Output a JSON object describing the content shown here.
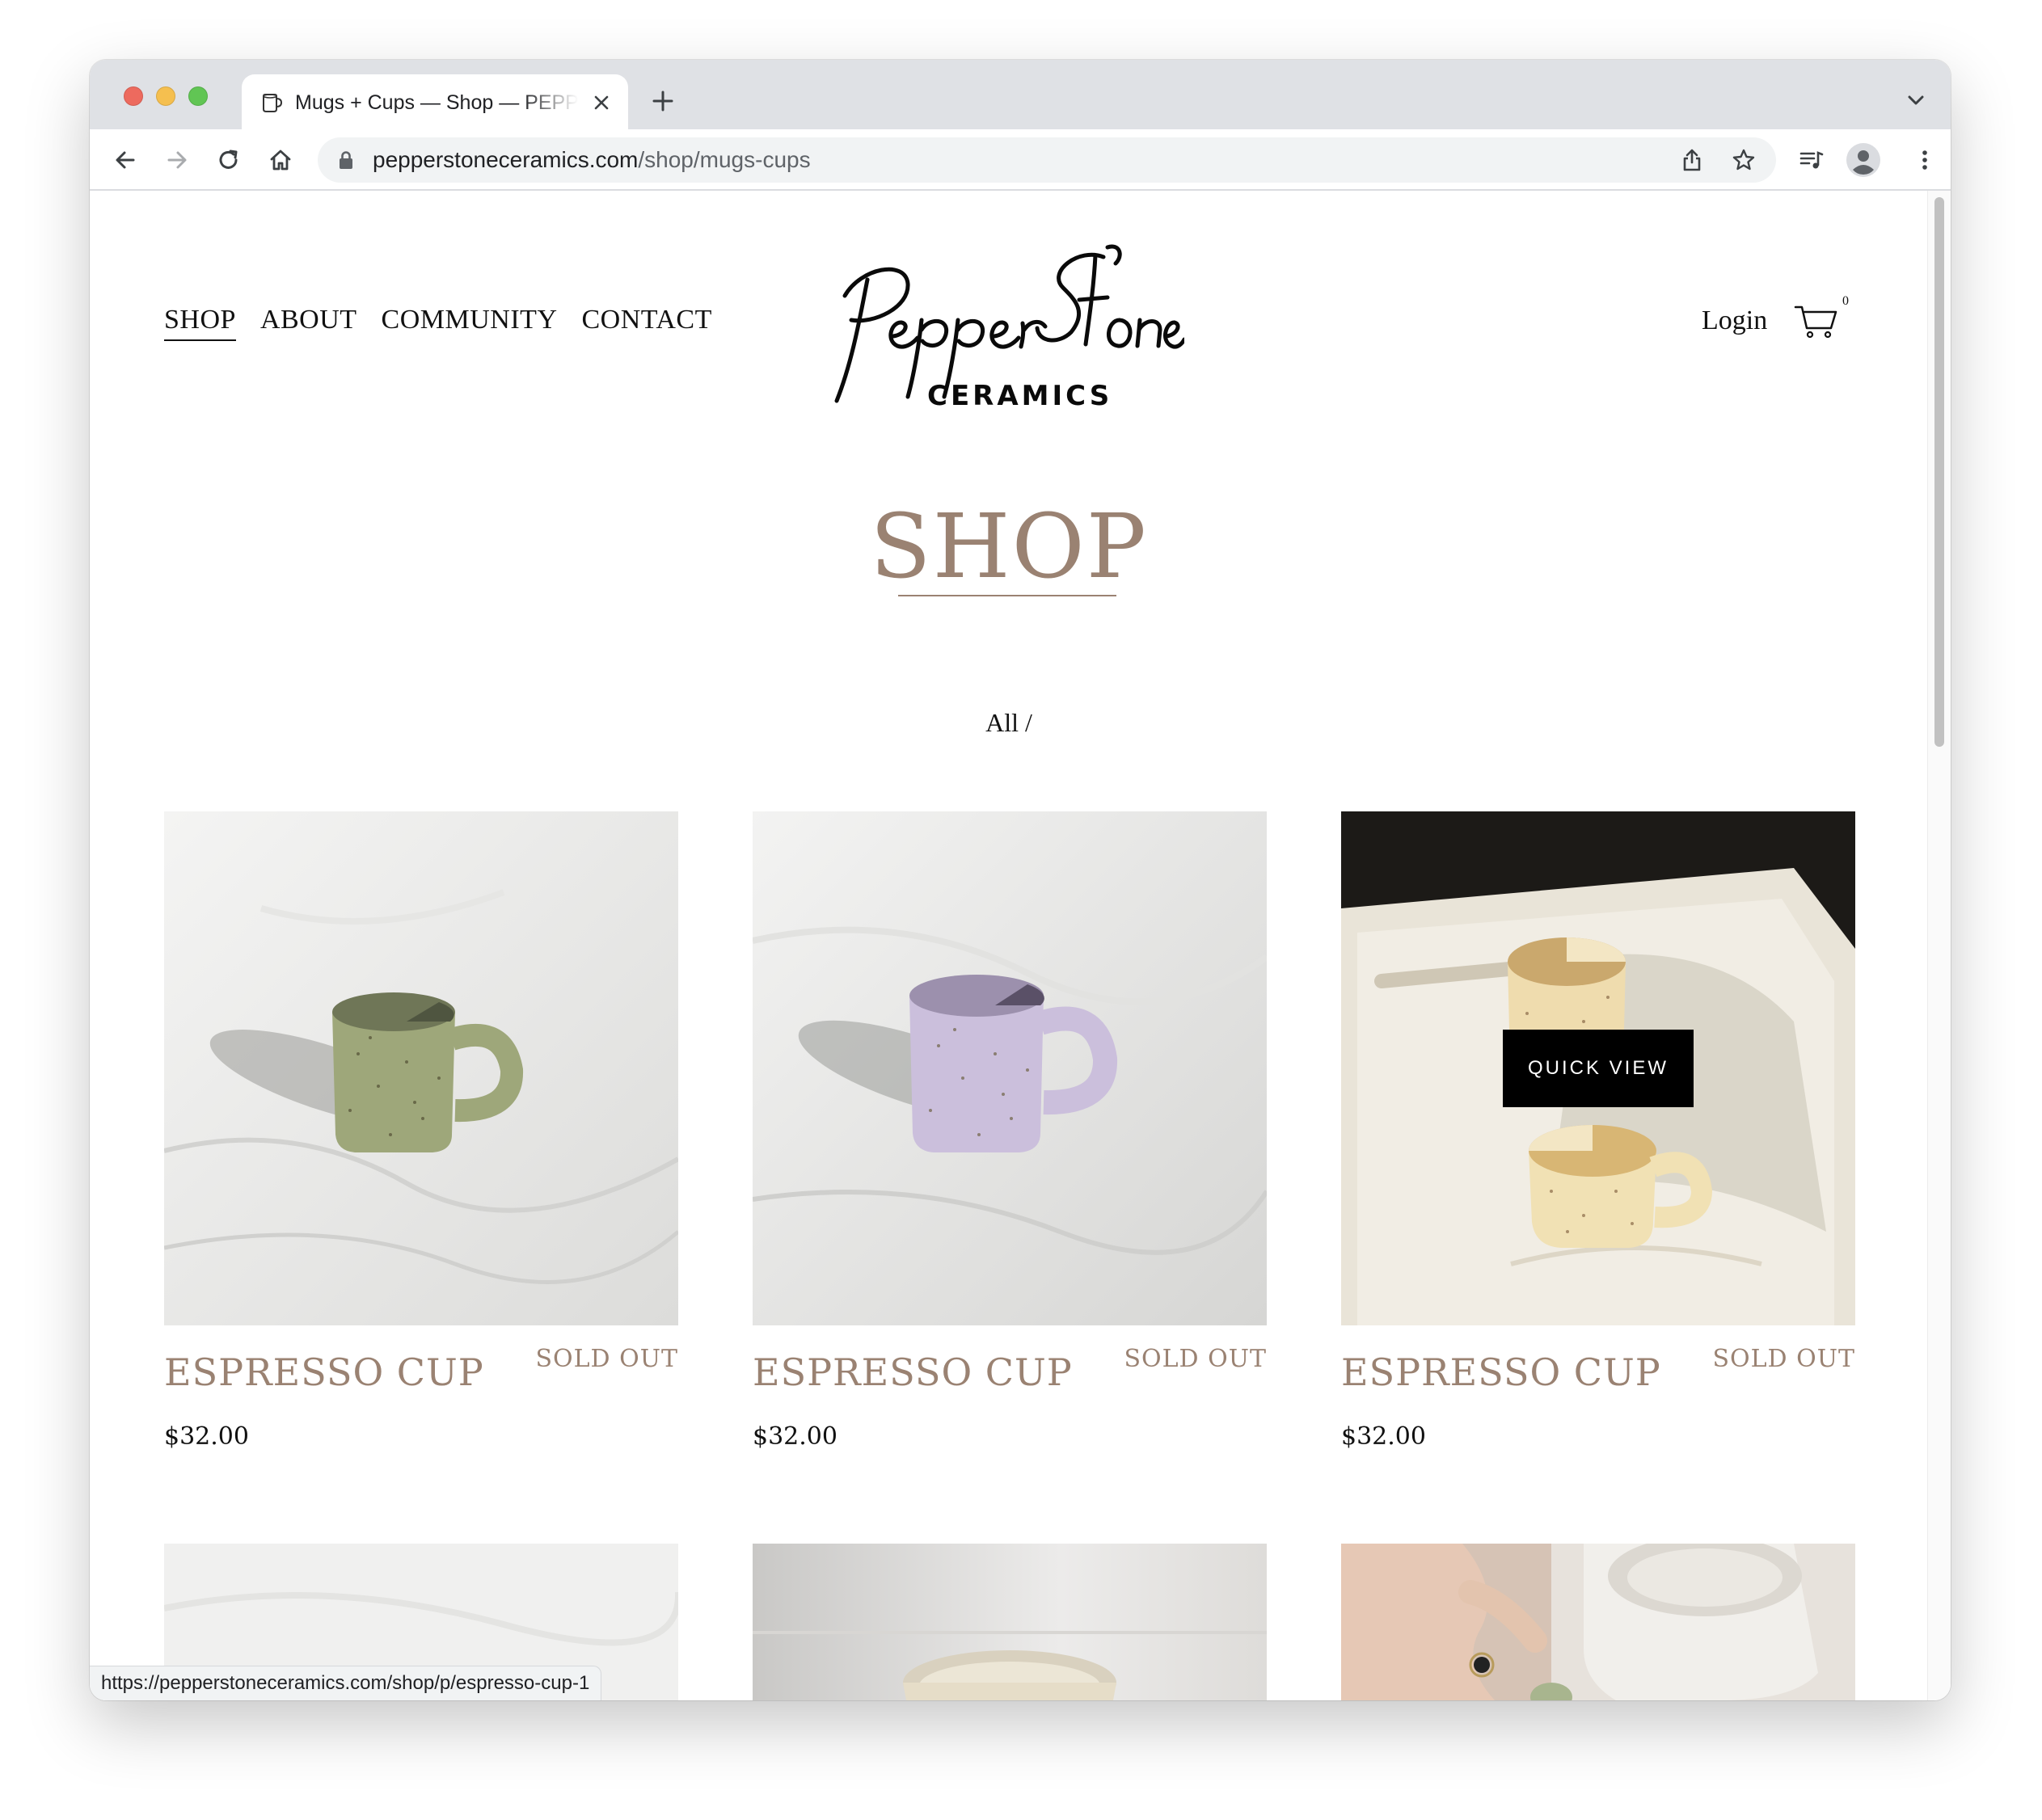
{
  "browser": {
    "tab_title": "Mugs + Cups — Shop — PEPPERSTONE CERAMICS",
    "url_host": "pepperstoneceramics.com",
    "url_path": "/shop/mugs-cups",
    "status_url": "https://pepperstoneceramics.com/shop/p/espresso-cup-1"
  },
  "site": {
    "nav": [
      "SHOP",
      "ABOUT",
      "COMMUNITY",
      "CONTACT"
    ],
    "active_nav": "SHOP",
    "logo_script": "Pepper Stone",
    "logo_sub": "CERAMICS",
    "login": "Login",
    "cart_count": "0"
  },
  "page": {
    "title": "SHOP",
    "filter": "All /"
  },
  "products": [
    {
      "name": "ESPRESSO CUP",
      "status": "SOLD OUT",
      "price": "$32.00",
      "image": "green-speckled-espresso-cup"
    },
    {
      "name": "ESPRESSO CUP",
      "status": "SOLD OUT",
      "price": "$32.00",
      "image": "lavender-speckled-espresso-cup"
    },
    {
      "name": "ESPRESSO CUP",
      "status": "SOLD OUT",
      "price": "$32.00",
      "image": "cream-espresso-cups-on-tray",
      "overlay": "QUICK VIEW"
    }
  ],
  "colors": {
    "accent": "#9a8272",
    "text": "#111111",
    "quick_view_bg": "#000000"
  }
}
